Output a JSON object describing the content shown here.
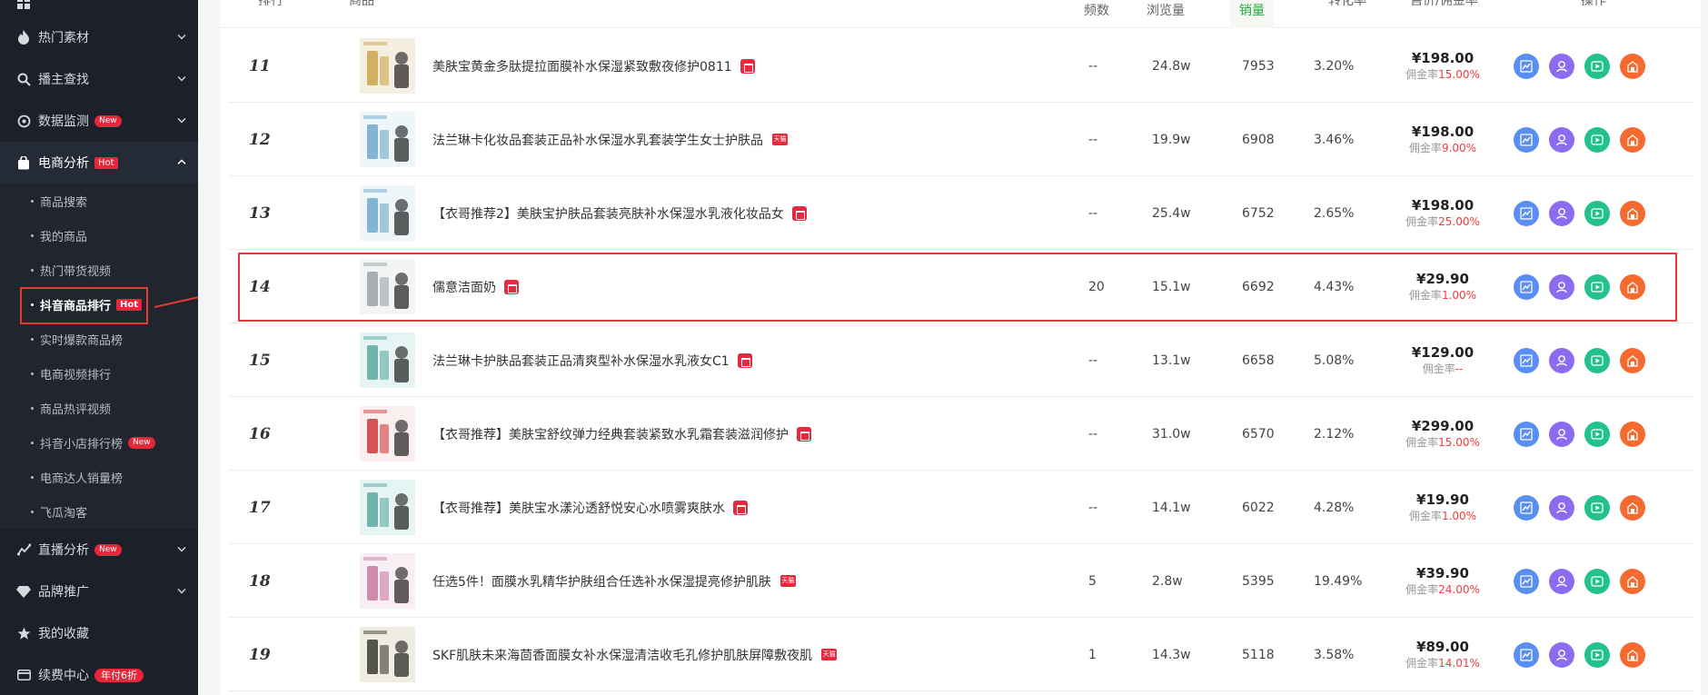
{
  "sidebar": {
    "items": [
      {
        "label": "热门素材",
        "icon": "fire-icon"
      },
      {
        "label": "播主查找",
        "icon": "search-icon"
      },
      {
        "label": "数据监测",
        "icon": "monitor-icon",
        "badge": "New"
      },
      {
        "label": "电商分析",
        "icon": "bag-icon",
        "badge": "Hot"
      },
      {
        "label": "直播分析",
        "icon": "chart-icon",
        "badge": "New"
      },
      {
        "label": "品牌推广",
        "icon": "diamond-icon"
      },
      {
        "label": "我的收藏",
        "icon": "star-icon"
      },
      {
        "label": "续费中心",
        "icon": "card-icon",
        "badge": "年付6折"
      }
    ],
    "sub_items": [
      {
        "label": "商品搜索"
      },
      {
        "label": "我的商品"
      },
      {
        "label": "热门带货视频"
      },
      {
        "label": "抖音商品排行",
        "badge": "Hot"
      },
      {
        "label": "实时爆款商品榜"
      },
      {
        "label": "电商视频排行"
      },
      {
        "label": "商品热评视频"
      },
      {
        "label": "抖音小店排行榜",
        "badge": "New"
      },
      {
        "label": "电商达人销量榜"
      },
      {
        "label": "飞瓜淘客"
      }
    ]
  },
  "table": {
    "headers": {
      "rank": "排行",
      "product": "商品",
      "frequency": "频数",
      "views": "浏览量",
      "sales": "销量",
      "conversion": "转化率",
      "price": "售价/佣金率",
      "actions": "操作"
    },
    "commission_label": "佣金率",
    "rows": [
      {
        "rank": "11",
        "title": "美肤宝黄金多肽提拉面膜补水保湿紧致敷夜修护0811",
        "shop": "store",
        "freq": "--",
        "views": "24.8w",
        "sales": "7953",
        "conv": "3.20%",
        "price": "¥198.00",
        "commission": "15.00%",
        "thumb": "gold"
      },
      {
        "rank": "12",
        "title": "法兰琳卡化妆品套装正品补水保湿水乳套装学生女士护肤品",
        "shop": "tmall",
        "freq": "--",
        "views": "19.9w",
        "sales": "6908",
        "conv": "3.46%",
        "price": "¥198.00",
        "commission": "9.00%",
        "thumb": "blue"
      },
      {
        "rank": "13",
        "title": "【衣哥推荐2】美肤宝护肤品套装亮肤补水保湿水乳液化妆品女",
        "shop": "store",
        "freq": "--",
        "views": "25.4w",
        "sales": "6752",
        "conv": "2.65%",
        "price": "¥198.00",
        "commission": "25.00%",
        "thumb": "blue"
      },
      {
        "rank": "14",
        "title": "儒意洁面奶",
        "shop": "store",
        "freq": "20",
        "views": "15.1w",
        "sales": "6692",
        "conv": "4.43%",
        "price": "¥29.90",
        "commission": "1.00%",
        "thumb": "white"
      },
      {
        "rank": "15",
        "title": "法兰琳卡护肤品套装正品清爽型补水保湿水乳液女C1",
        "shop": "store",
        "freq": "--",
        "views": "13.1w",
        "sales": "6658",
        "conv": "5.08%",
        "price": "¥129.00",
        "commission": "--",
        "thumb": "teal"
      },
      {
        "rank": "16",
        "title": "【衣哥推荐】美肤宝舒纹弹力经典套装紧致水乳霜套装滋润修护",
        "shop": "store",
        "freq": "--",
        "views": "31.0w",
        "sales": "6570",
        "conv": "2.12%",
        "price": "¥299.00",
        "commission": "15.00%",
        "thumb": "red"
      },
      {
        "rank": "17",
        "title": "【衣哥推荐】美肤宝水漾沁透舒悦安心水喷雾爽肤水",
        "shop": "store",
        "freq": "--",
        "views": "14.1w",
        "sales": "6022",
        "conv": "4.28%",
        "price": "¥19.90",
        "commission": "1.00%",
        "thumb": "teal"
      },
      {
        "rank": "18",
        "title": "任选5件！面膜水乳精华护肤组合任选补水保湿提亮修护肌肤",
        "shop": "tmall",
        "freq": "5",
        "views": "2.8w",
        "sales": "5395",
        "conv": "19.49%",
        "price": "¥39.90",
        "commission": "24.00%",
        "thumb": "pink"
      },
      {
        "rank": "19",
        "title": "SKF肌肤未来海茴香面膜女补水保湿清洁收毛孔修护肌肤屏障敷夜肌",
        "shop": "tmall",
        "freq": "1",
        "views": "14.3w",
        "sales": "5118",
        "conv": "3.58%",
        "price": "¥89.00",
        "commission": "14.01%",
        "thumb": "dark"
      }
    ]
  },
  "shop_badges": {
    "store": "店铺",
    "tmall": "天猫"
  },
  "colors": {
    "accent": "#e53935",
    "sidebar_bg": "#1b2029",
    "sales_header": "#26a83c",
    "commission": "#f23b3b"
  }
}
